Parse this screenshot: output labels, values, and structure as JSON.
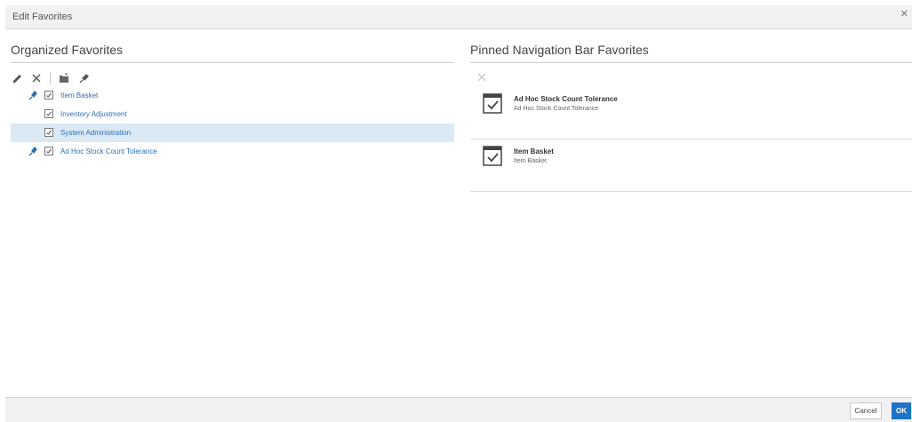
{
  "dialog": {
    "title": "Edit Favorites",
    "close_icon": "close-icon"
  },
  "organized": {
    "title": "Organized Favorites",
    "toolbar": [
      "rename-icon",
      "delete-icon",
      "new-folder-icon",
      "pin-icon"
    ],
    "items": [
      {
        "label": "Item Basket",
        "pinned": true,
        "selected": false
      },
      {
        "label": "Inventory Adjustment",
        "pinned": false,
        "selected": false
      },
      {
        "label": "System Administration",
        "pinned": false,
        "selected": true
      },
      {
        "label": "Ad Hoc Stock Count Tolerance",
        "pinned": true,
        "selected": false
      }
    ]
  },
  "pinned": {
    "title": "Pinned Navigation Bar Favorites",
    "toolbar": [
      "remove-icon"
    ],
    "items": [
      {
        "title": "Ad Hoc Stock Count Tolerance",
        "subtitle": "Ad Hoc Stock Count Tolerance"
      },
      {
        "title": "Item Basket",
        "subtitle": "Item Basket"
      }
    ]
  },
  "footer": {
    "cancel_label": "Cancel",
    "ok_label": "OK"
  },
  "colors": {
    "link": "#2e6fb6",
    "selected_row": "#dbe9f5",
    "primary_button": "#1e73c8"
  }
}
